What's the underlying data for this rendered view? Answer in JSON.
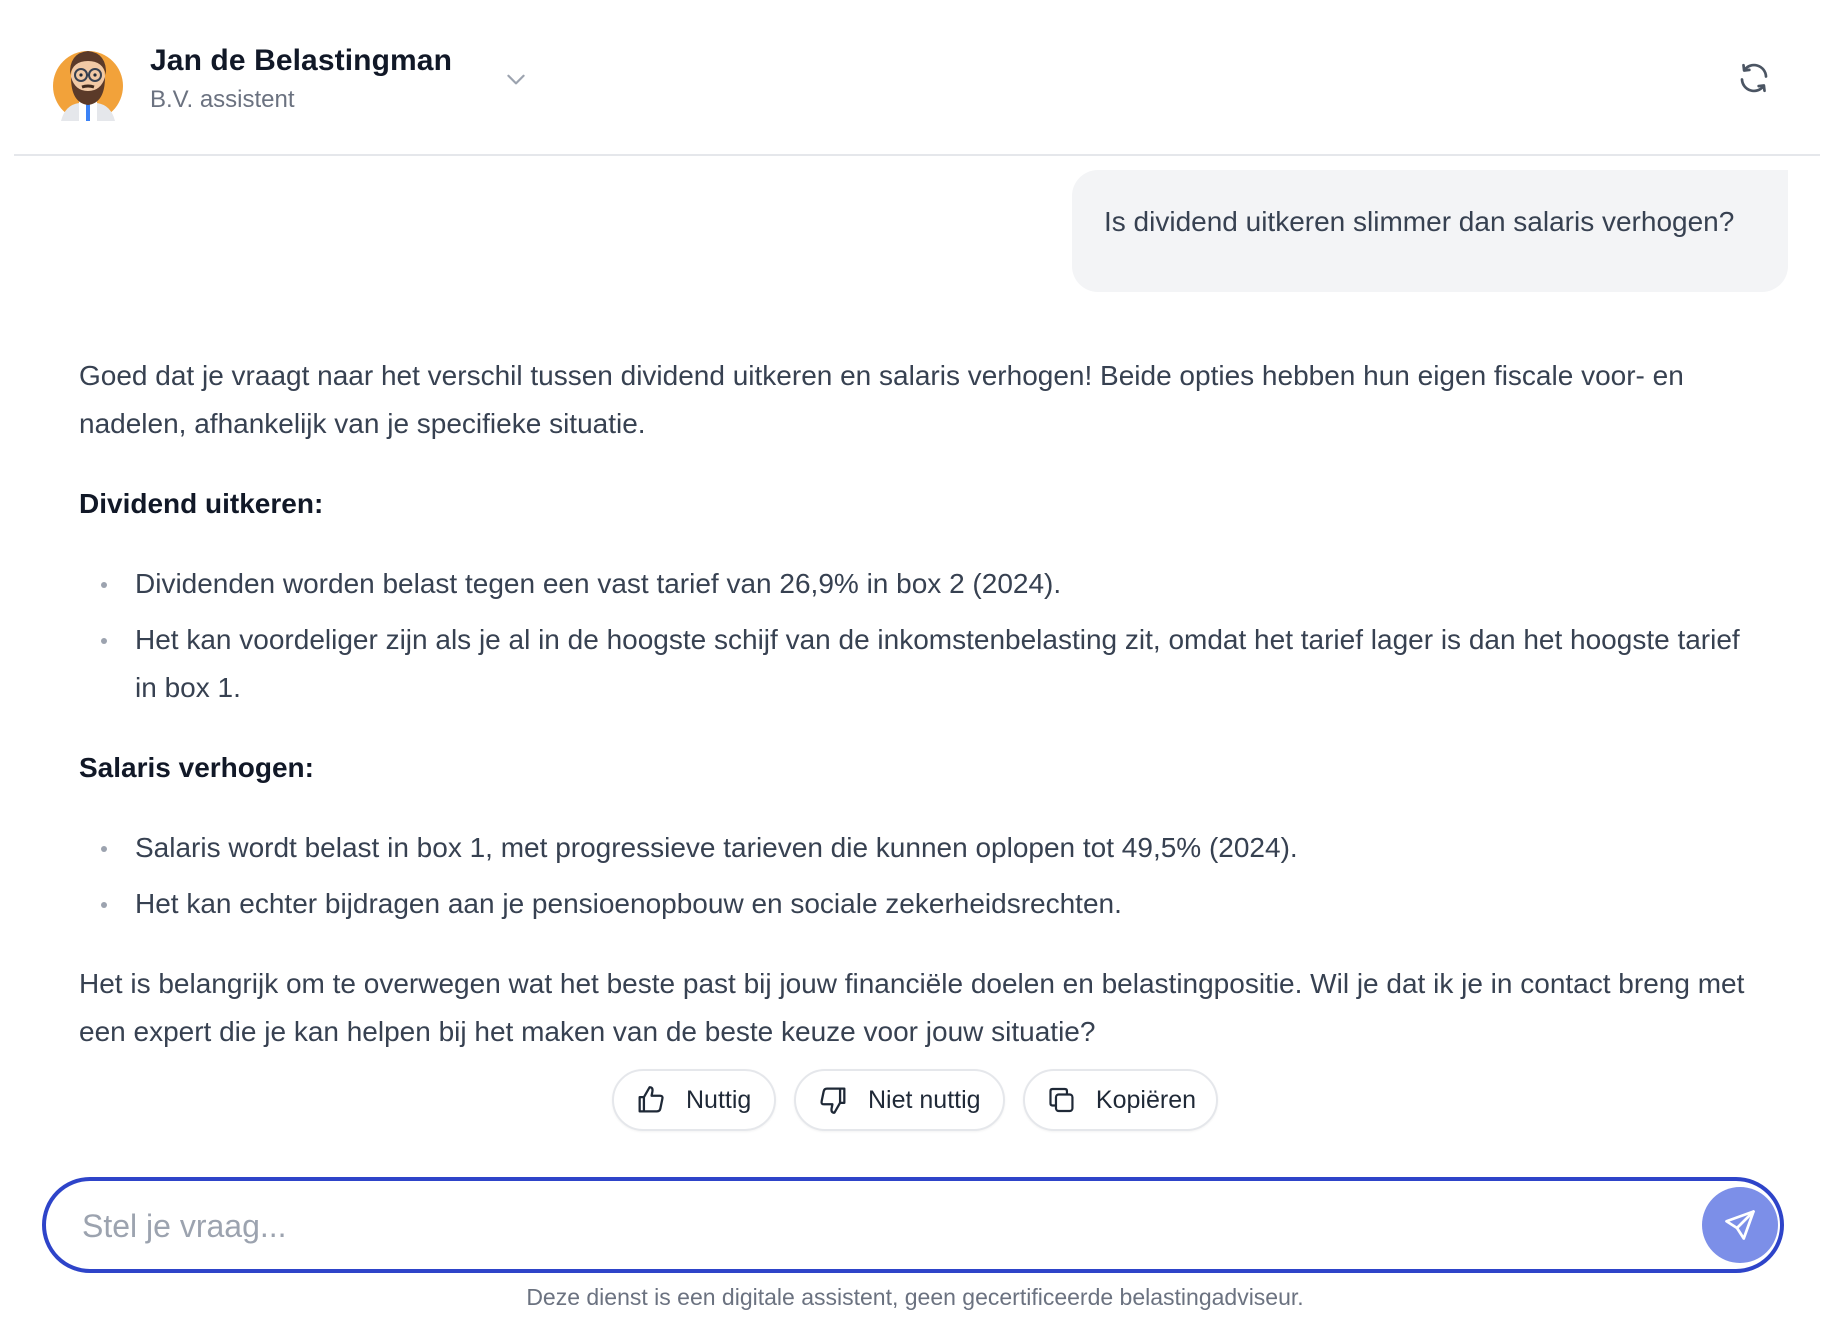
{
  "header": {
    "agent_name": "Jan de Belastingman",
    "agent_role": "B.V. assistent",
    "icons": {
      "avatar": "bearded-man-avatar",
      "dropdown": "chevron-down-icon",
      "refresh": "refresh-icon"
    }
  },
  "conversation": {
    "user_message": "Is dividend uitkeren slimmer dan salaris verhogen?",
    "assistant": {
      "intro": "Goed dat je vraagt naar het verschil tussen dividend uitkeren en salaris verhogen! Beide opties hebben hun eigen fiscale voor- en nadelen, afhankelijk van je specifieke situatie.",
      "sections": [
        {
          "heading": "Dividend uitkeren:",
          "bullets": [
            "Dividenden worden belast tegen een vast tarief van 26,9% in box 2 (2024).",
            "Het kan voordeliger zijn als je al in de hoogste schijf van de inkomstenbelasting zit, omdat het tarief lager is dan het hoogste tarief in box 1."
          ]
        },
        {
          "heading": "Salaris verhogen:",
          "bullets": [
            "Salaris wordt belast in box 1, met progressieve tarieven die kunnen oplopen tot 49,5% (2024).",
            "Het kan echter bijdragen aan je pensioenopbouw en sociale zekerheidsrechten."
          ]
        }
      ],
      "closing": "Het is belangrijk om te overwegen wat het beste past bij jouw financiële doelen en belastingpositie. Wil je dat ik je in contact breng met een expert die je kan helpen bij het maken van de beste keuze voor jouw situatie?"
    }
  },
  "feedback": {
    "useful_label": "Nuttig",
    "not_useful_label": "Niet nuttig",
    "copy_label": "Kopiëren"
  },
  "composer": {
    "placeholder": "Stel je vraag...",
    "value": "",
    "send_icon": "send-icon",
    "accent_color": "#2e44c9",
    "send_color": "#7c8fe8"
  },
  "footer": {
    "disclaimer": "Deze dienst is een digitale assistent, geen gecertificeerde belastingadviseur."
  }
}
